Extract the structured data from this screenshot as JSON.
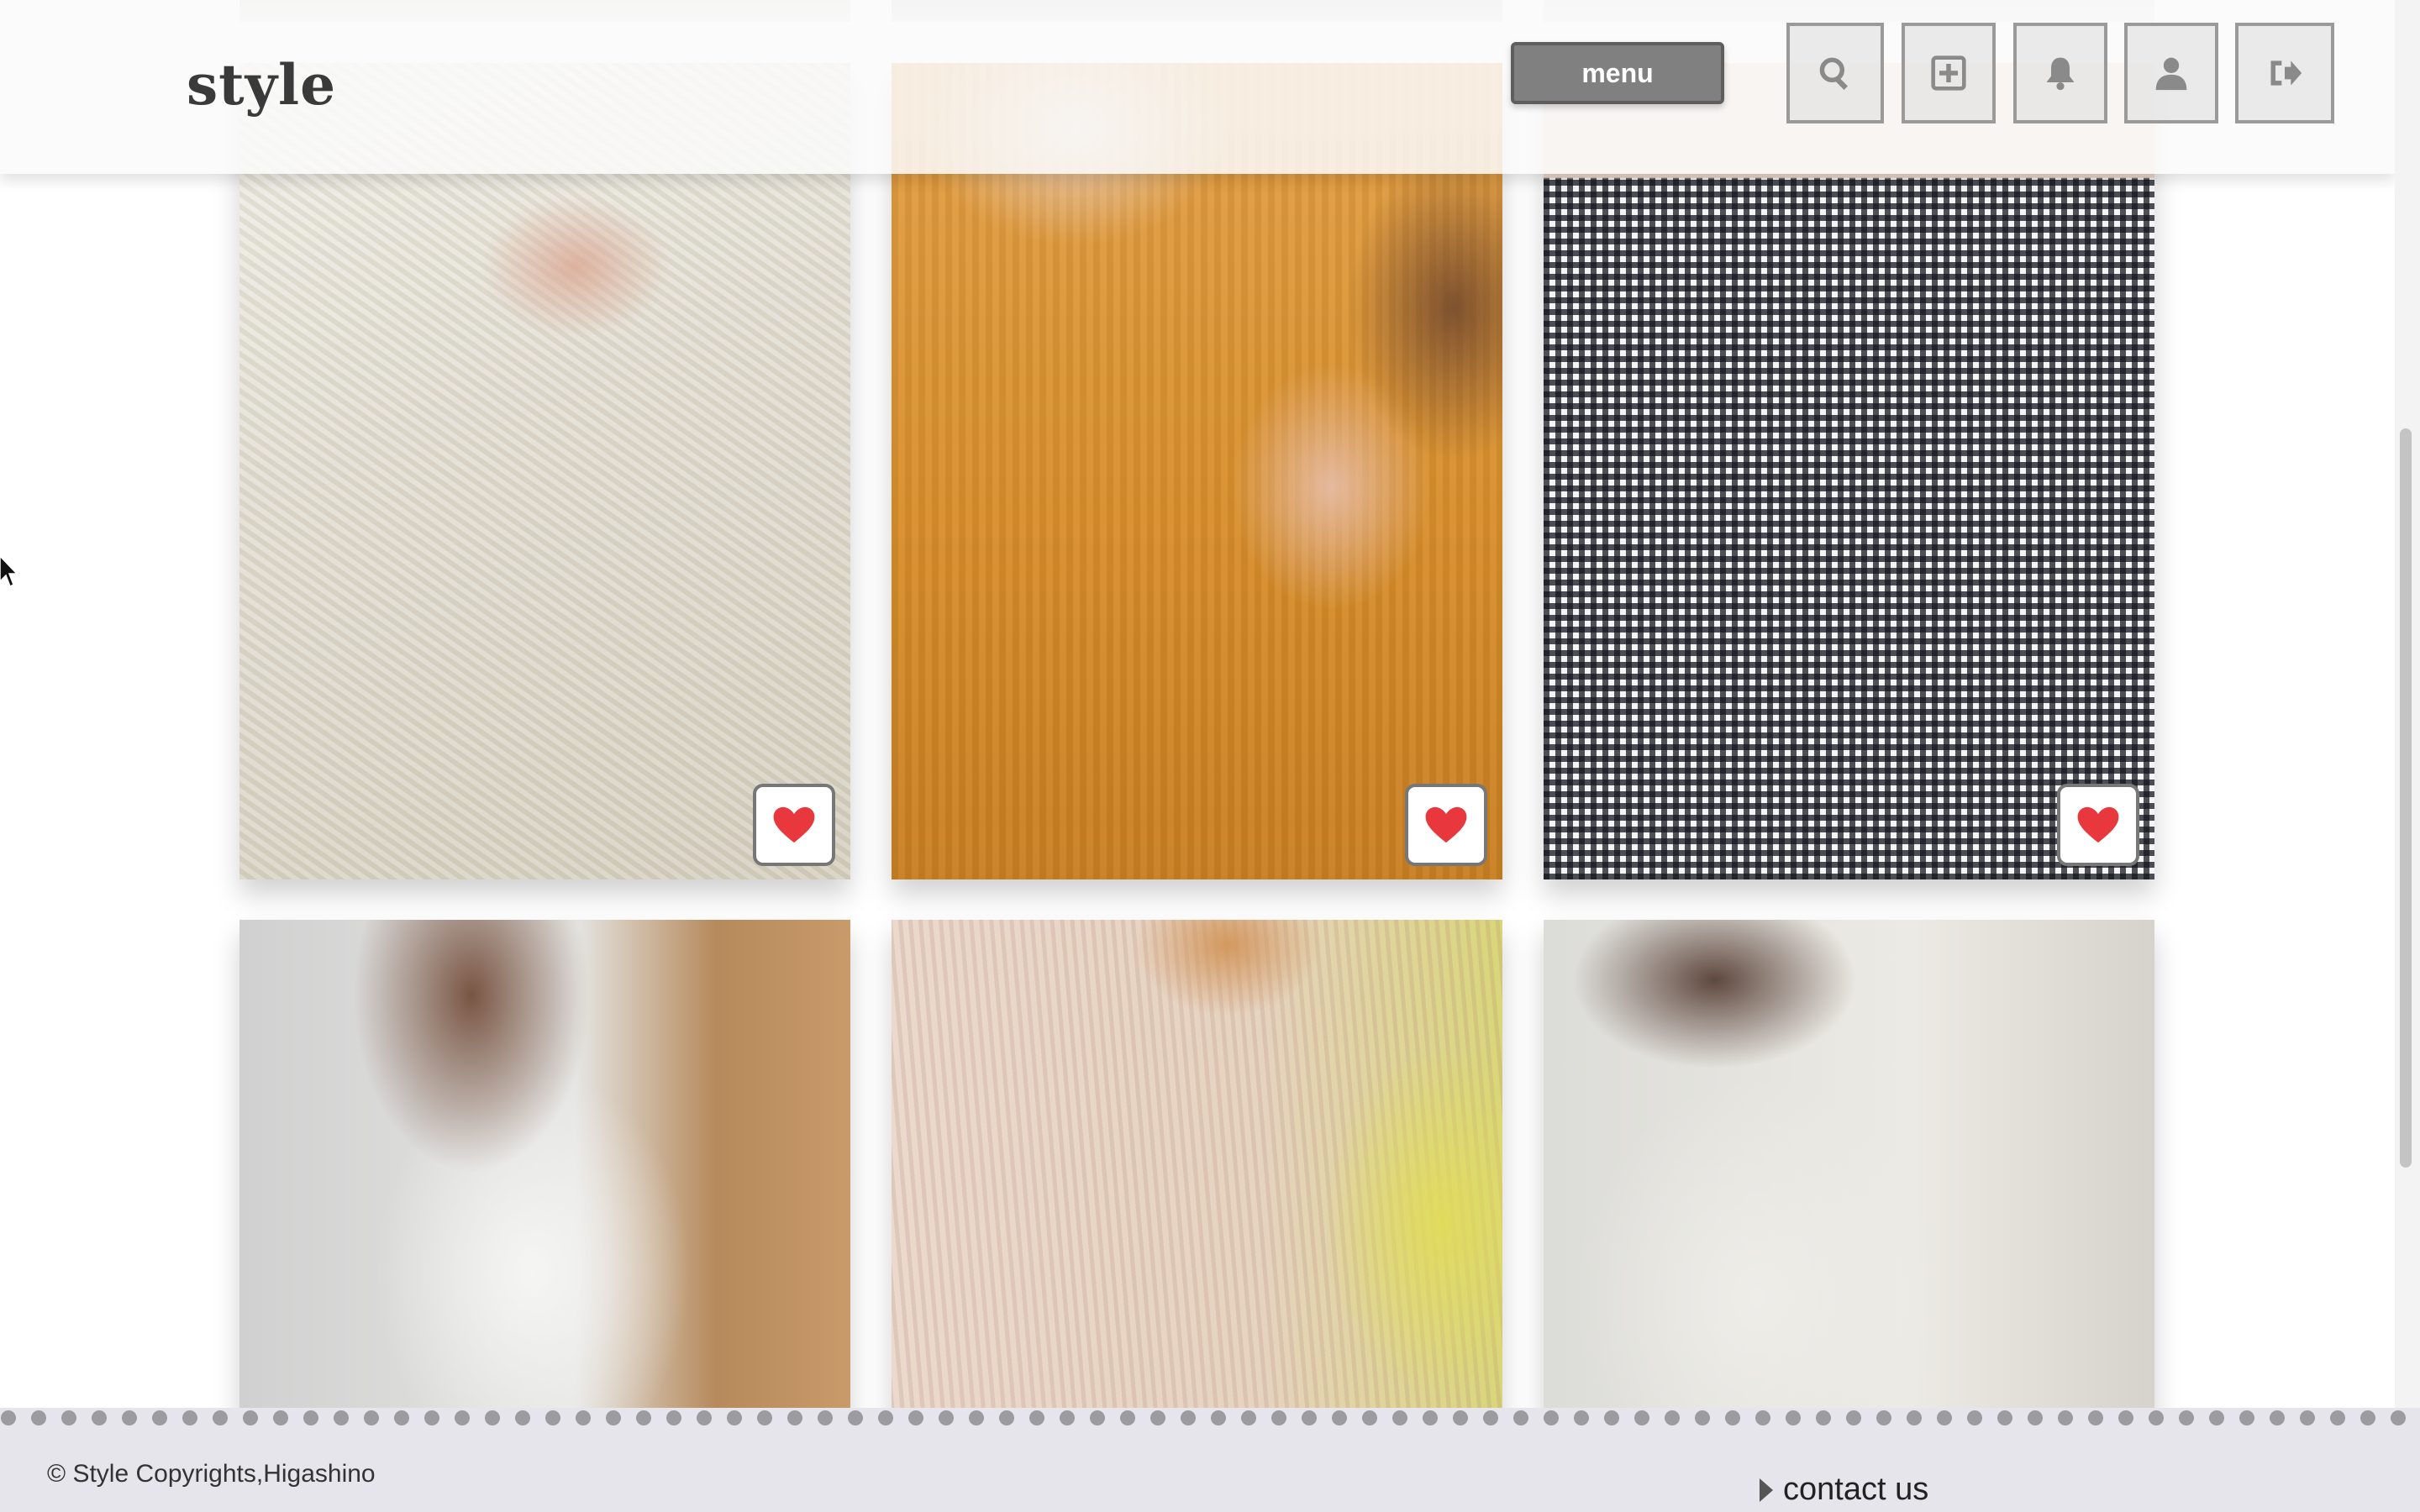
{
  "header": {
    "logo": "style",
    "menu_label": "menu",
    "icons": [
      "search-icon",
      "plus-square-icon",
      "bell-icon",
      "user-icon",
      "sign-out-icon"
    ]
  },
  "gallery": {
    "posts": [
      {
        "name": "lace-dress-ring",
        "liked": true
      },
      {
        "name": "mustard-cardigan-necklace",
        "liked": true
      },
      {
        "name": "gingham-top-necklace",
        "liked": true
      },
      {
        "name": "white-puff-sleeve-dress",
        "liked": false
      },
      {
        "name": "floral-pleated-blouse",
        "liked": false
      },
      {
        "name": "white-cardigan",
        "liked": false
      }
    ],
    "like_color": "#e8383d"
  },
  "footer": {
    "copyright": "© Style Copyrights,Higashino",
    "contact_label": "contact us"
  }
}
